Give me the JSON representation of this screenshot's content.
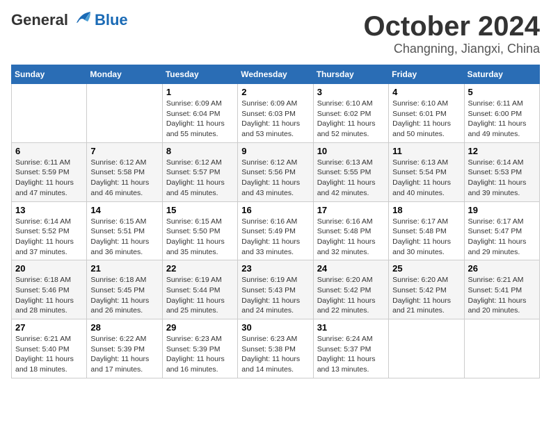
{
  "header": {
    "logo": {
      "general": "General",
      "blue": "Blue"
    },
    "month": "October 2024",
    "location": "Changning, Jiangxi, China"
  },
  "weekdays": [
    "Sunday",
    "Monday",
    "Tuesday",
    "Wednesday",
    "Thursday",
    "Friday",
    "Saturday"
  ],
  "weeks": [
    [
      {
        "day": "",
        "sunrise": "",
        "sunset": "",
        "daylight": ""
      },
      {
        "day": "",
        "sunrise": "",
        "sunset": "",
        "daylight": ""
      },
      {
        "day": "1",
        "sunrise": "Sunrise: 6:09 AM",
        "sunset": "Sunset: 6:04 PM",
        "daylight": "Daylight: 11 hours and 55 minutes."
      },
      {
        "day": "2",
        "sunrise": "Sunrise: 6:09 AM",
        "sunset": "Sunset: 6:03 PM",
        "daylight": "Daylight: 11 hours and 53 minutes."
      },
      {
        "day": "3",
        "sunrise": "Sunrise: 6:10 AM",
        "sunset": "Sunset: 6:02 PM",
        "daylight": "Daylight: 11 hours and 52 minutes."
      },
      {
        "day": "4",
        "sunrise": "Sunrise: 6:10 AM",
        "sunset": "Sunset: 6:01 PM",
        "daylight": "Daylight: 11 hours and 50 minutes."
      },
      {
        "day": "5",
        "sunrise": "Sunrise: 6:11 AM",
        "sunset": "Sunset: 6:00 PM",
        "daylight": "Daylight: 11 hours and 49 minutes."
      }
    ],
    [
      {
        "day": "6",
        "sunrise": "Sunrise: 6:11 AM",
        "sunset": "Sunset: 5:59 PM",
        "daylight": "Daylight: 11 hours and 47 minutes."
      },
      {
        "day": "7",
        "sunrise": "Sunrise: 6:12 AM",
        "sunset": "Sunset: 5:58 PM",
        "daylight": "Daylight: 11 hours and 46 minutes."
      },
      {
        "day": "8",
        "sunrise": "Sunrise: 6:12 AM",
        "sunset": "Sunset: 5:57 PM",
        "daylight": "Daylight: 11 hours and 45 minutes."
      },
      {
        "day": "9",
        "sunrise": "Sunrise: 6:12 AM",
        "sunset": "Sunset: 5:56 PM",
        "daylight": "Daylight: 11 hours and 43 minutes."
      },
      {
        "day": "10",
        "sunrise": "Sunrise: 6:13 AM",
        "sunset": "Sunset: 5:55 PM",
        "daylight": "Daylight: 11 hours and 42 minutes."
      },
      {
        "day": "11",
        "sunrise": "Sunrise: 6:13 AM",
        "sunset": "Sunset: 5:54 PM",
        "daylight": "Daylight: 11 hours and 40 minutes."
      },
      {
        "day": "12",
        "sunrise": "Sunrise: 6:14 AM",
        "sunset": "Sunset: 5:53 PM",
        "daylight": "Daylight: 11 hours and 39 minutes."
      }
    ],
    [
      {
        "day": "13",
        "sunrise": "Sunrise: 6:14 AM",
        "sunset": "Sunset: 5:52 PM",
        "daylight": "Daylight: 11 hours and 37 minutes."
      },
      {
        "day": "14",
        "sunrise": "Sunrise: 6:15 AM",
        "sunset": "Sunset: 5:51 PM",
        "daylight": "Daylight: 11 hours and 36 minutes."
      },
      {
        "day": "15",
        "sunrise": "Sunrise: 6:15 AM",
        "sunset": "Sunset: 5:50 PM",
        "daylight": "Daylight: 11 hours and 35 minutes."
      },
      {
        "day": "16",
        "sunrise": "Sunrise: 6:16 AM",
        "sunset": "Sunset: 5:49 PM",
        "daylight": "Daylight: 11 hours and 33 minutes."
      },
      {
        "day": "17",
        "sunrise": "Sunrise: 6:16 AM",
        "sunset": "Sunset: 5:48 PM",
        "daylight": "Daylight: 11 hours and 32 minutes."
      },
      {
        "day": "18",
        "sunrise": "Sunrise: 6:17 AM",
        "sunset": "Sunset: 5:48 PM",
        "daylight": "Daylight: 11 hours and 30 minutes."
      },
      {
        "day": "19",
        "sunrise": "Sunrise: 6:17 AM",
        "sunset": "Sunset: 5:47 PM",
        "daylight": "Daylight: 11 hours and 29 minutes."
      }
    ],
    [
      {
        "day": "20",
        "sunrise": "Sunrise: 6:18 AM",
        "sunset": "Sunset: 5:46 PM",
        "daylight": "Daylight: 11 hours and 28 minutes."
      },
      {
        "day": "21",
        "sunrise": "Sunrise: 6:18 AM",
        "sunset": "Sunset: 5:45 PM",
        "daylight": "Daylight: 11 hours and 26 minutes."
      },
      {
        "day": "22",
        "sunrise": "Sunrise: 6:19 AM",
        "sunset": "Sunset: 5:44 PM",
        "daylight": "Daylight: 11 hours and 25 minutes."
      },
      {
        "day": "23",
        "sunrise": "Sunrise: 6:19 AM",
        "sunset": "Sunset: 5:43 PM",
        "daylight": "Daylight: 11 hours and 24 minutes."
      },
      {
        "day": "24",
        "sunrise": "Sunrise: 6:20 AM",
        "sunset": "Sunset: 5:42 PM",
        "daylight": "Daylight: 11 hours and 22 minutes."
      },
      {
        "day": "25",
        "sunrise": "Sunrise: 6:20 AM",
        "sunset": "Sunset: 5:42 PM",
        "daylight": "Daylight: 11 hours and 21 minutes."
      },
      {
        "day": "26",
        "sunrise": "Sunrise: 6:21 AM",
        "sunset": "Sunset: 5:41 PM",
        "daylight": "Daylight: 11 hours and 20 minutes."
      }
    ],
    [
      {
        "day": "27",
        "sunrise": "Sunrise: 6:21 AM",
        "sunset": "Sunset: 5:40 PM",
        "daylight": "Daylight: 11 hours and 18 minutes."
      },
      {
        "day": "28",
        "sunrise": "Sunrise: 6:22 AM",
        "sunset": "Sunset: 5:39 PM",
        "daylight": "Daylight: 11 hours and 17 minutes."
      },
      {
        "day": "29",
        "sunrise": "Sunrise: 6:23 AM",
        "sunset": "Sunset: 5:39 PM",
        "daylight": "Daylight: 11 hours and 16 minutes."
      },
      {
        "day": "30",
        "sunrise": "Sunrise: 6:23 AM",
        "sunset": "Sunset: 5:38 PM",
        "daylight": "Daylight: 11 hours and 14 minutes."
      },
      {
        "day": "31",
        "sunrise": "Sunrise: 6:24 AM",
        "sunset": "Sunset: 5:37 PM",
        "daylight": "Daylight: 11 hours and 13 minutes."
      },
      {
        "day": "",
        "sunrise": "",
        "sunset": "",
        "daylight": ""
      },
      {
        "day": "",
        "sunrise": "",
        "sunset": "",
        "daylight": ""
      }
    ]
  ]
}
